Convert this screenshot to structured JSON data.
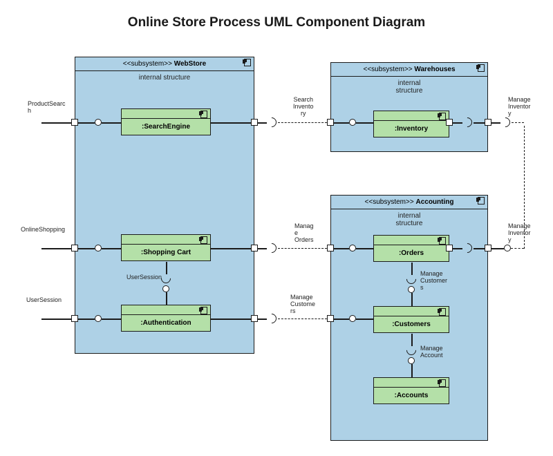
{
  "title": "Online Store Process UML Component Diagram",
  "subsystems": {
    "webstore": {
      "stereotype": "<<subsystem>>",
      "name": "WebStore",
      "internal": "internal structure"
    },
    "warehouses": {
      "stereotype": "<<subsystem>>",
      "name": "Warehouses",
      "internal": "internal\nstructure"
    },
    "accounting": {
      "stereotype": "<<subsystem>>",
      "name": "Accounting",
      "internal": "internal\nstructure"
    }
  },
  "components": {
    "searchEngine": ":SearchEngine",
    "shoppingCart": ":Shopping Cart",
    "authentication": ":Authentication",
    "inventory": ":Inventory",
    "orders": ":Orders",
    "customers": ":Customers",
    "accounts": ":Accounts"
  },
  "interfaces": {
    "productSearch": "ProductSearc\nh",
    "onlineShopping": "OnlineShopping",
    "userSessionExt": "UserSession",
    "userSessionInt": "UserSession",
    "searchInventory": "Search\nInvento\nry",
    "manageInventoryTop": "Manage\nInventor\ny",
    "manageOrders": "Manag\ne\nOrders",
    "manageInventoryRight": "Manage\nInventor\ny",
    "manageCustomersExt": "Manage\nCustome\nrs",
    "manageCustomersInt": "Manage\nCustomer\ns",
    "manageAccount": "Manage\nAccount"
  }
}
